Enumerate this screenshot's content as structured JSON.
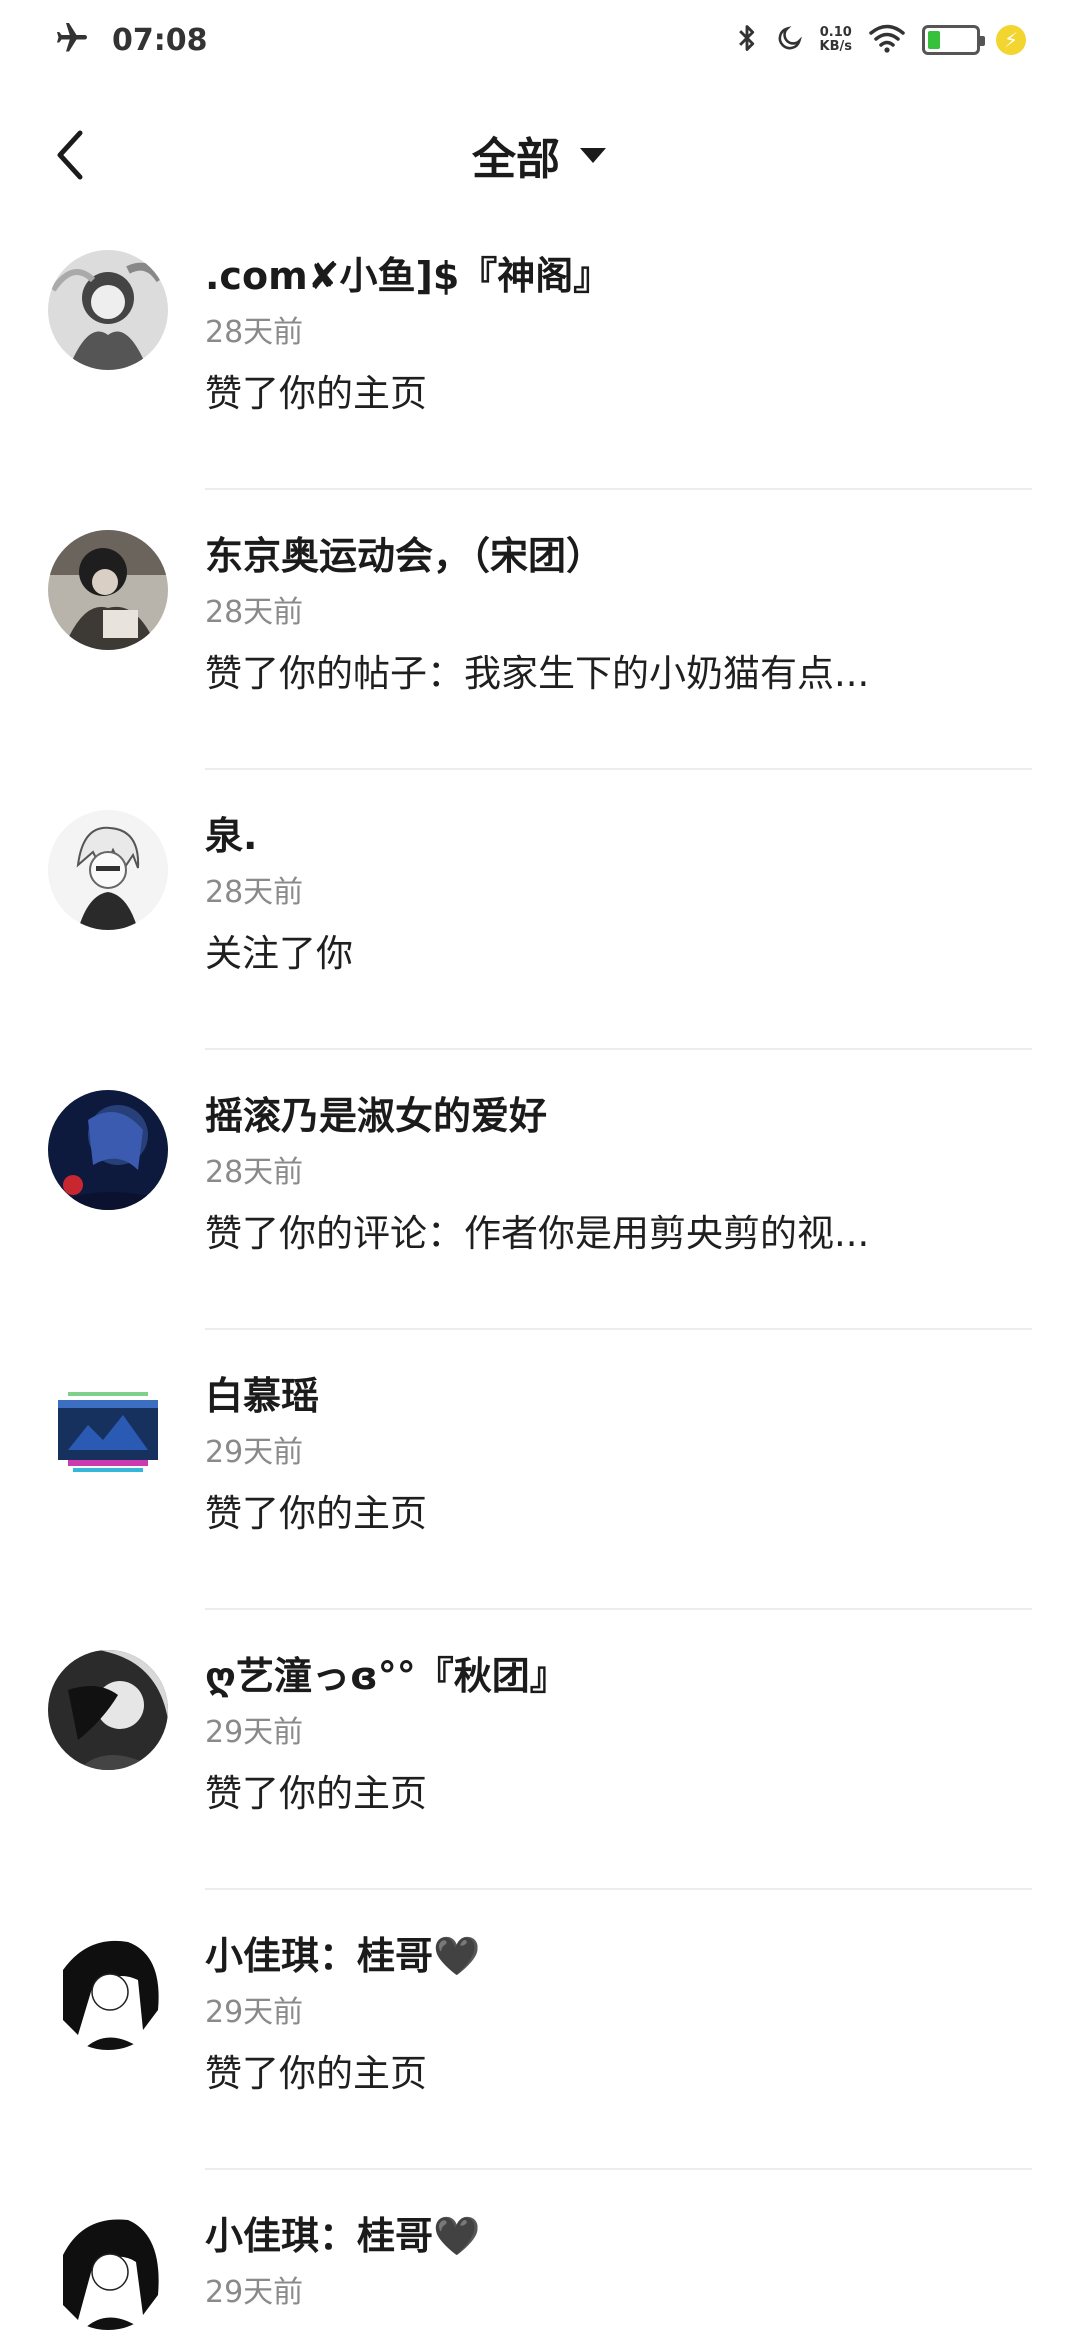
{
  "status_bar": {
    "time": "07:08",
    "net_speed_value": "0.10",
    "net_speed_unit": "KB/s",
    "battery_color": "#37c13a",
    "battery_level": 0.25,
    "icons": [
      "airplane-icon",
      "bluetooth-icon",
      "moon-icon",
      "wifi-icon",
      "battery-icon",
      "charging-icon"
    ]
  },
  "header": {
    "back_icon": "chevron-left-icon",
    "title": "全部",
    "dropdown_icon": "caret-down-icon"
  },
  "notifications": [
    {
      "name": ".com✘小鱼]$『神阁』",
      "time": "28天前",
      "action": "赞了你的主页",
      "avatar": "avatar-1"
    },
    {
      "name": "东京奥运动会，（宋团）",
      "time": "28天前",
      "action": "赞了你的帖子：我家生下的小奶猫有点...",
      "avatar": "avatar-2"
    },
    {
      "name": "泉.",
      "time": "28天前",
      "action": "关注了你",
      "avatar": "avatar-3"
    },
    {
      "name": "摇滚乃是淑女的爱好",
      "time": "28天前",
      "action": "赞了你的评论：作者你是用剪央剪的视...",
      "avatar": "avatar-4"
    },
    {
      "name": "白慕瑶",
      "time": "29天前",
      "action": "赞了你的主页",
      "avatar": "avatar-5"
    },
    {
      "name": "ღ艺潼っɞ°°『秋团』",
      "time": "29天前",
      "action": "赞了你的主页",
      "avatar": "avatar-6"
    },
    {
      "name": "小佳琪：桂哥🖤",
      "time": "29天前",
      "action": "赞了你的主页",
      "avatar": "avatar-7"
    },
    {
      "name": "小佳琪：桂哥🖤",
      "time": "29天前",
      "action": "",
      "avatar": "avatar-8"
    }
  ]
}
